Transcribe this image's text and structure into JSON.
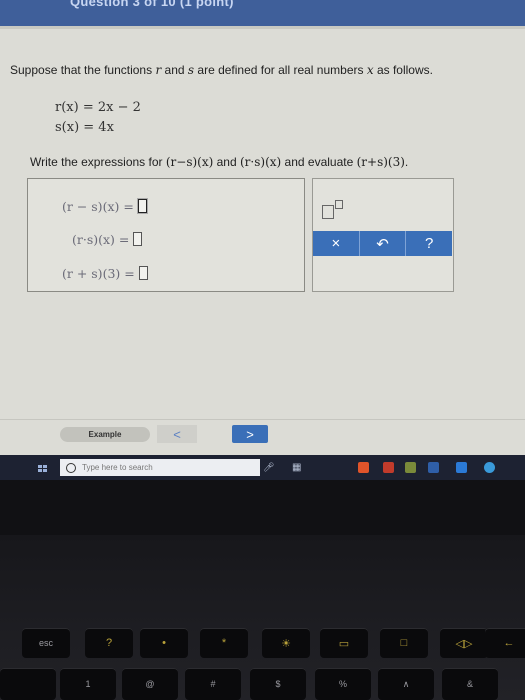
{
  "header": {
    "title": "Question 3 of 10 (1 point)"
  },
  "question": {
    "prefix": "Suppose that the functions ",
    "var_r": "r",
    "mid1": " and ",
    "var_s": "s",
    "mid2": " are defined for all real numbers ",
    "var_x": "x",
    "suffix": " as follows."
  },
  "functions": [
    "r(x) = 2x − 2",
    "s(x) = 4x"
  ],
  "instruction": {
    "prefix": "Write the expressions for ",
    "expr1": "(r−s)(x)",
    "mid1": " and ",
    "expr2": "(r·s)(x)",
    "mid2": " and evaluate ",
    "expr3": "(r+s)(3)",
    "suffix": "."
  },
  "answers": [
    {
      "label": "(r − s)(x) =",
      "value": ""
    },
    {
      "label": "(r·s)(x) =",
      "value": ""
    },
    {
      "label": "(r + s)(3) =",
      "value": ""
    }
  ],
  "palette": {
    "clear": "×",
    "undo": "↶",
    "help": "?"
  },
  "navigation": {
    "example": "Example",
    "back": "<",
    "next": ">"
  },
  "taskbar": {
    "search_placeholder": "Type here to search",
    "app_colors": [
      "#e0542a",
      "#c13b2b",
      "#7a8a3a",
      "#2f5fa8",
      "#2b7ad6",
      "#3a9ad9"
    ]
  },
  "keyboard": {
    "fn_row": [
      "esc",
      "?",
      "•",
      "*",
      "☀",
      "▭",
      "□",
      "◁▷",
      "←"
    ],
    "num_row": [
      "",
      "1",
      "@",
      "#",
      "$",
      "%",
      "∧",
      "&"
    ]
  },
  "colors": {
    "accent": "#3a6fb8",
    "taskbar": "#1d2232",
    "header": "#3f5f9a"
  }
}
